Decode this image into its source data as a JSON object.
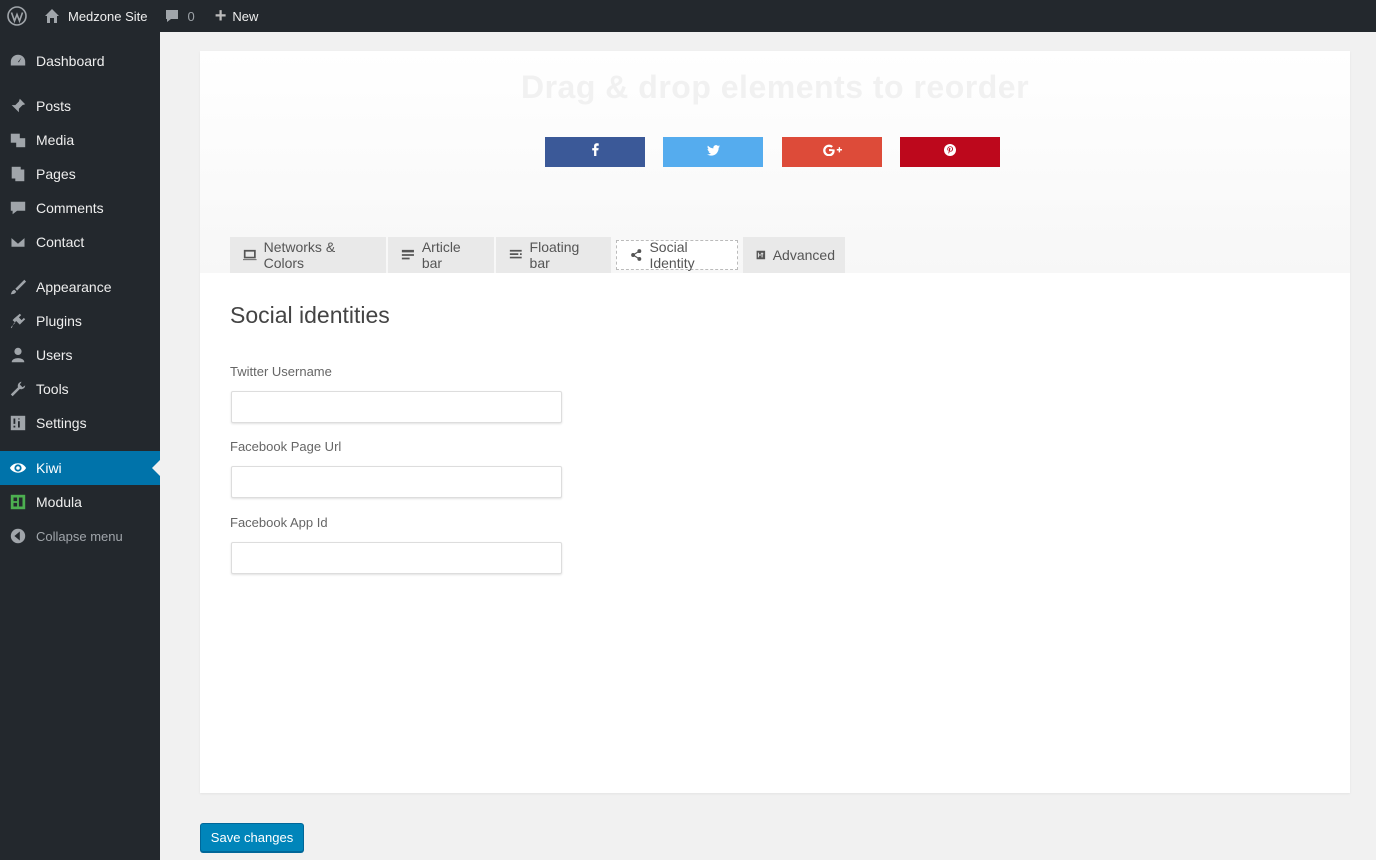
{
  "adminbar": {
    "site_name": "Medzone Site",
    "comments_count": "0",
    "new_label": "New"
  },
  "sidebar": {
    "items": [
      {
        "label": "Dashboard",
        "icon": "dashboard-icon"
      },
      {
        "label": "Posts",
        "icon": "pin-icon"
      },
      {
        "label": "Media",
        "icon": "media-icon"
      },
      {
        "label": "Pages",
        "icon": "pages-icon"
      },
      {
        "label": "Comments",
        "icon": "comment-icon"
      },
      {
        "label": "Contact",
        "icon": "envelope-icon"
      },
      {
        "label": "Appearance",
        "icon": "brush-icon"
      },
      {
        "label": "Plugins",
        "icon": "plug-icon"
      },
      {
        "label": "Users",
        "icon": "user-icon"
      },
      {
        "label": "Tools",
        "icon": "wrench-icon"
      },
      {
        "label": "Settings",
        "icon": "sliders-icon"
      },
      {
        "label": "Kiwi",
        "icon": "kiwi-icon",
        "active": true
      },
      {
        "label": "Modula",
        "icon": "modula-icon"
      },
      {
        "label": "Collapse menu",
        "icon": "collapse-icon"
      }
    ]
  },
  "preview": {
    "title": "Drag & drop elements to reorder",
    "buttons": [
      {
        "network": "facebook",
        "icon": "facebook-icon",
        "color": "#3b5998"
      },
      {
        "network": "twitter",
        "icon": "twitter-icon",
        "color": "#55acee"
      },
      {
        "network": "google-plus",
        "icon": "google-plus-icon",
        "color": "#dd4b39"
      },
      {
        "network": "pinterest",
        "icon": "pinterest-icon",
        "color": "#bd081c"
      }
    ]
  },
  "tabs": [
    {
      "label": "Networks & Colors",
      "icon": "monitor-icon"
    },
    {
      "label": "Article bar",
      "icon": "article-bar-icon"
    },
    {
      "label": "Floating bar",
      "icon": "floating-bar-icon"
    },
    {
      "label": "Social Identity",
      "icon": "share-icon",
      "active": true
    },
    {
      "label": "Advanced",
      "icon": "advanced-icon"
    }
  ],
  "form": {
    "section_title": "Social identities",
    "fields": [
      {
        "label": "Twitter Username",
        "value": ""
      },
      {
        "label": "Facebook Page Url",
        "value": ""
      },
      {
        "label": "Facebook App Id",
        "value": ""
      }
    ]
  },
  "save_label": "Save changes",
  "colors": {
    "admin_dark": "#23282d",
    "accent": "#0073aa",
    "primary_button": "#0085ba"
  }
}
